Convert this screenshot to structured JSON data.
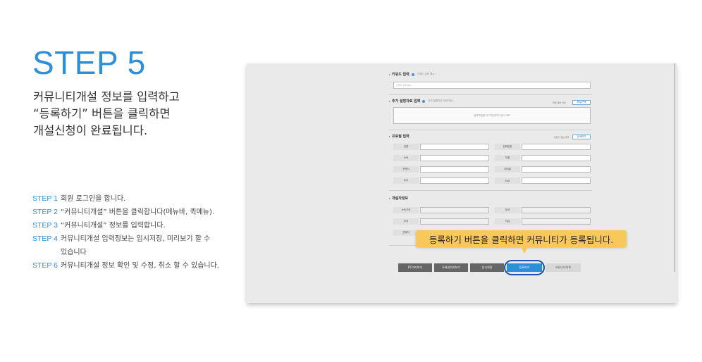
{
  "header": {
    "title": "STEP 5",
    "intro_lines": [
      "커뮤니티개설 정보를 입력하고",
      "“등록하기” 버튼을 클릭하면",
      "개설신청이 완료됩니다."
    ]
  },
  "steps": [
    {
      "label": "STEP 1",
      "text": "회원 로그인을 합니다."
    },
    {
      "label": "STEP 2",
      "text": "“커뮤니티개설” 버튼을 클릭합니다(메뉴바, 퀵메뉴)."
    },
    {
      "label": "STEP 3",
      "text": "“커뮤니티개설” 정보를 입력합니다."
    },
    {
      "label": "STEP 4",
      "text": "커뮤니티개설 입력정보는 임시저장, 미리보기 할 수"
    },
    {
      "label": "",
      "text": "있습니다"
    },
    {
      "label": "STEP 6",
      "text": "커뮤니티개설 정보 확인 및 수정, 취소 할 수 있습니다."
    }
  ],
  "screenshot": {
    "keyword_section": {
      "title": "키워드 입력",
      "hint": "키워드 입력 예시...",
      "input_text": "검색어 입력 예시..."
    },
    "attachment_section": {
      "title": "추가 설명자료 입력",
      "hint": "추가 설명자료 입력 예시...",
      "note": "파일 첨부 안내",
      "button": "파일선택",
      "drop_text": "첨부파일을 여기에 끌어다 놓으세요"
    },
    "professional_section": {
      "title": "프로필 입력",
      "note": "전문가 정보 입력",
      "button": "검색하기",
      "rows": [
        {
          "left_label": "성명",
          "left_value": "",
          "right_label": "전화번호",
          "right_value": ""
        },
        {
          "left_label": "소속",
          "left_value": "",
          "right_label": "직위",
          "right_value": ""
        },
        {
          "left_label": "연락처",
          "left_value": "",
          "right_label": "이메일",
          "right_value": ""
        },
        {
          "left_label": "주소",
          "left_value": "",
          "right_label": "FAX",
          "right_value": ""
        }
      ]
    },
    "operator_section": {
      "title": "개설자정보",
      "rows": [
        {
          "left_label": "소속기관",
          "left_value": "",
          "right_label": "부서",
          "right_value": ""
        },
        {
          "left_label": "부서",
          "left_value": "",
          "right_label": "직급",
          "right_value": ""
        },
        {
          "left_label": "연락처",
          "left_value": "",
          "right_label": "",
          "right_value": ""
        }
      ]
    },
    "buttons": {
      "preview_pc": "PC미리보기",
      "preview_mobile": "모바일미리보기",
      "temp_save": "임시저장",
      "register": "등록하기",
      "list": "커뮤니티목록"
    },
    "callout": "등록하기 버튼을 클릭하면 커뮤니티가 등록됩니다."
  }
}
